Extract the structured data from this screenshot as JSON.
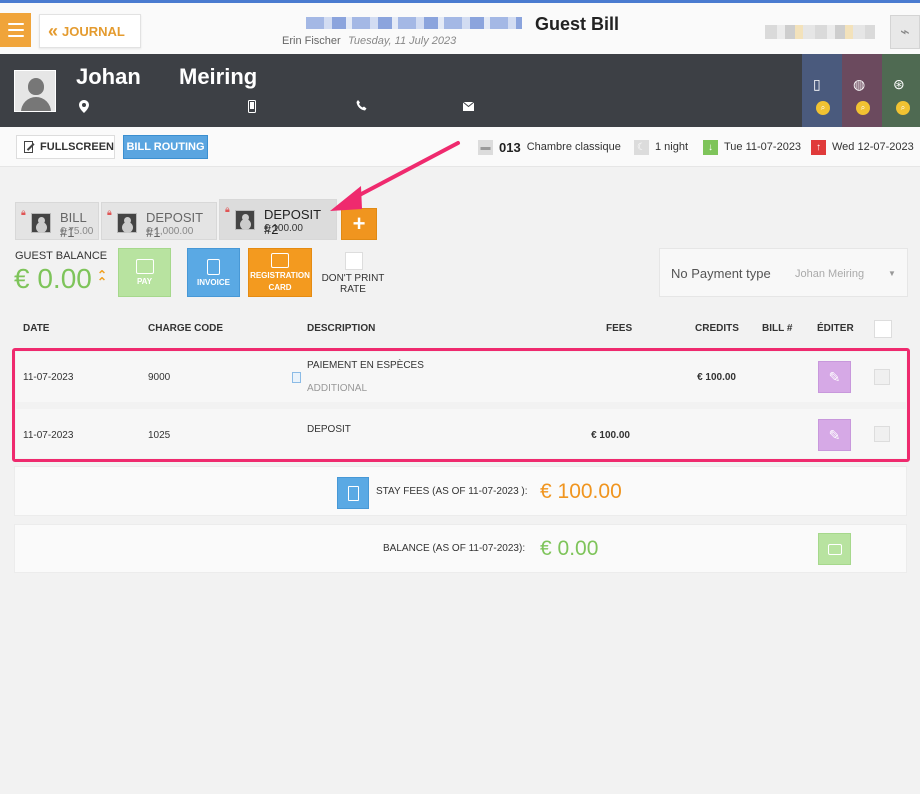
{
  "header": {
    "journal_label": "JOURNAL",
    "title": "Guest Bill",
    "user": "Erin Fischer",
    "date": "Tuesday, 11 July 2023"
  },
  "guest": {
    "first_name": "Johan",
    "last_name": "Meiring"
  },
  "toolbar": {
    "fullscreen_label": "FULLSCREEN",
    "bill_routing_label": "BILL ROUTING"
  },
  "reservation": {
    "room_number": "013",
    "room_type": "Chambre classique",
    "nights": "1 night",
    "arrival": "Tue 11-07-2023",
    "departure": "Wed 12-07-2023"
  },
  "bills": [
    {
      "name": "BILL #1",
      "amount": "€ 75.00"
    },
    {
      "name": "DEPOSIT #1",
      "amount": "€ 1,000.00"
    },
    {
      "name": "DEPOSIT #2",
      "amount": "€ 100.00",
      "active": true
    }
  ],
  "balance": {
    "label": "GUEST BALANCE",
    "value": "€ 0.00"
  },
  "actions": {
    "pay": "PAY",
    "invoice": "INVOICE",
    "registration_line1": "REGISTRATION",
    "registration_line2": "CARD",
    "dont_print_line1": "DON'T PRINT",
    "dont_print_line2": "RATE"
  },
  "payment": {
    "type_label": "No Payment type",
    "guest_name": "Johan Meiring"
  },
  "table": {
    "headers": {
      "date": "DATE",
      "charge_code": "CHARGE CODE",
      "description": "DESCRIPTION",
      "fees": "FEES",
      "credits": "CREDITS",
      "bill": "BILL #",
      "edit": "ÉDITER"
    },
    "rows": [
      {
        "date": "11-07-2023",
        "code": "9000",
        "description": "PAIEMENT EN ESPÈCES",
        "sub": "ADDITIONAL",
        "fees": "",
        "credits": "€ 100.00"
      },
      {
        "date": "11-07-2023",
        "code": "1025",
        "description": "DEPOSIT",
        "sub": "",
        "fees": "€ 100.00",
        "credits": ""
      }
    ]
  },
  "summary": {
    "stay_label": "STAY FEES (AS OF  11-07-2023 ):",
    "stay_value": "€ 100.00",
    "balance_label": "BALANCE (AS OF  11-07-2023):",
    "balance_value": "€ 0.00"
  },
  "colors": {
    "accent_orange": "#f0951f",
    "green": "#7ec45a",
    "blue": "#5aa9e4",
    "highlight": "#ef2a6e",
    "band": "#3d4045"
  }
}
